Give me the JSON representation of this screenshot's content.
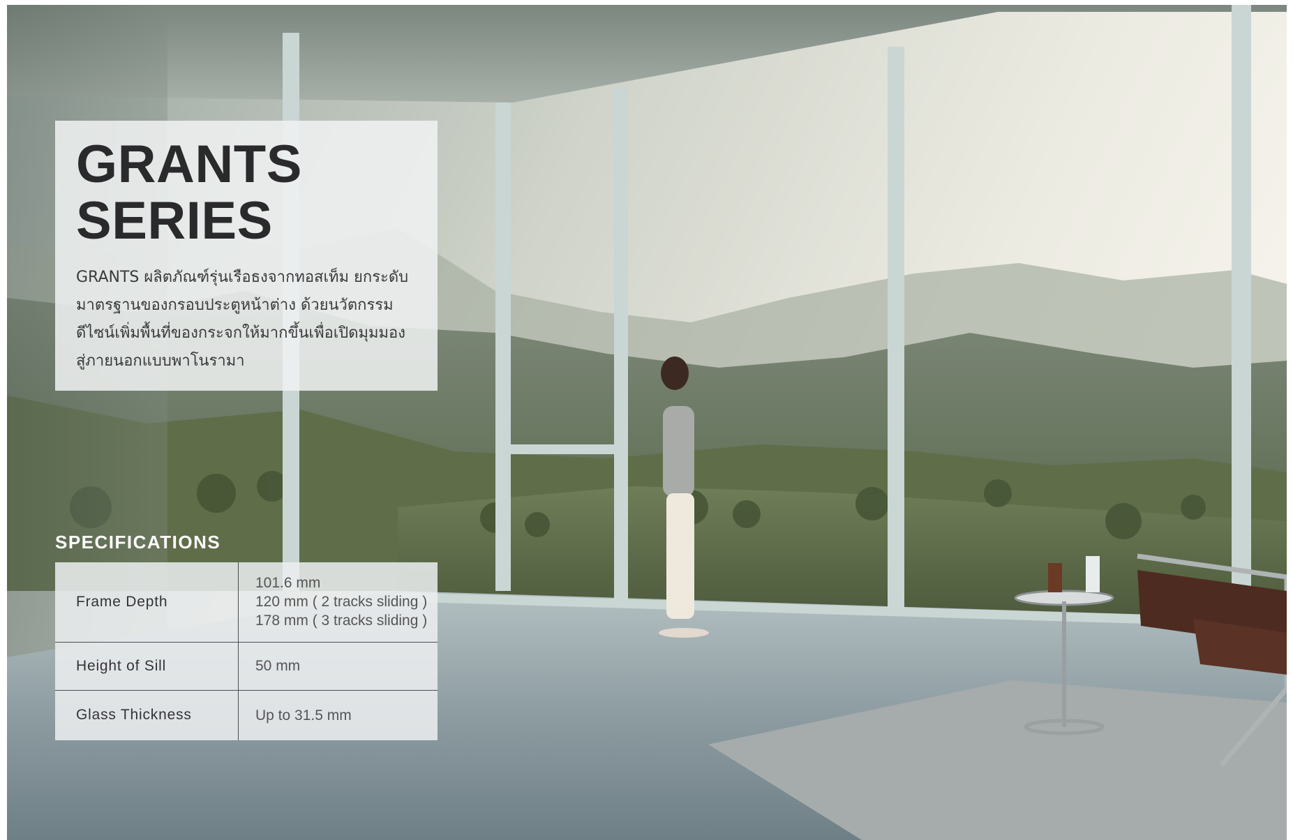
{
  "hero": {
    "title_lines": [
      "GRANTS",
      "SERIES"
    ],
    "description_lines": [
      "GRANTS ผลิตภัณฑ์รุ่นเรือธงจากทอสเท็ม ยกระดับ",
      "มาตรฐานของกรอบประตูหน้าต่าง ด้วยนวัตกรรม",
      "ดีไซน์เพิ่มพื้นที่ของกระจกให้มากขึ้นเพื่อเปิดมุมมอง",
      "สู่ภายนอกแบบพาโนรามา"
    ]
  },
  "specifications": {
    "heading": "SPECIFICATIONS",
    "rows": [
      {
        "label": "Frame Depth",
        "values": [
          "101.6 mm",
          "120 mm ( 2 tracks sliding )",
          "178 mm ( 3 tracks sliding )"
        ]
      },
      {
        "label": "Height of Sill",
        "values": [
          "50 mm"
        ]
      },
      {
        "label": "Glass Thickness",
        "values": [
          "Up to 31.5 mm"
        ]
      }
    ]
  },
  "colors": {
    "title_text": "#2a2a2c",
    "panel_background": "#f0f2f2",
    "heading_text": "#ffffff",
    "frame_mullion": "#c9d6d4"
  }
}
